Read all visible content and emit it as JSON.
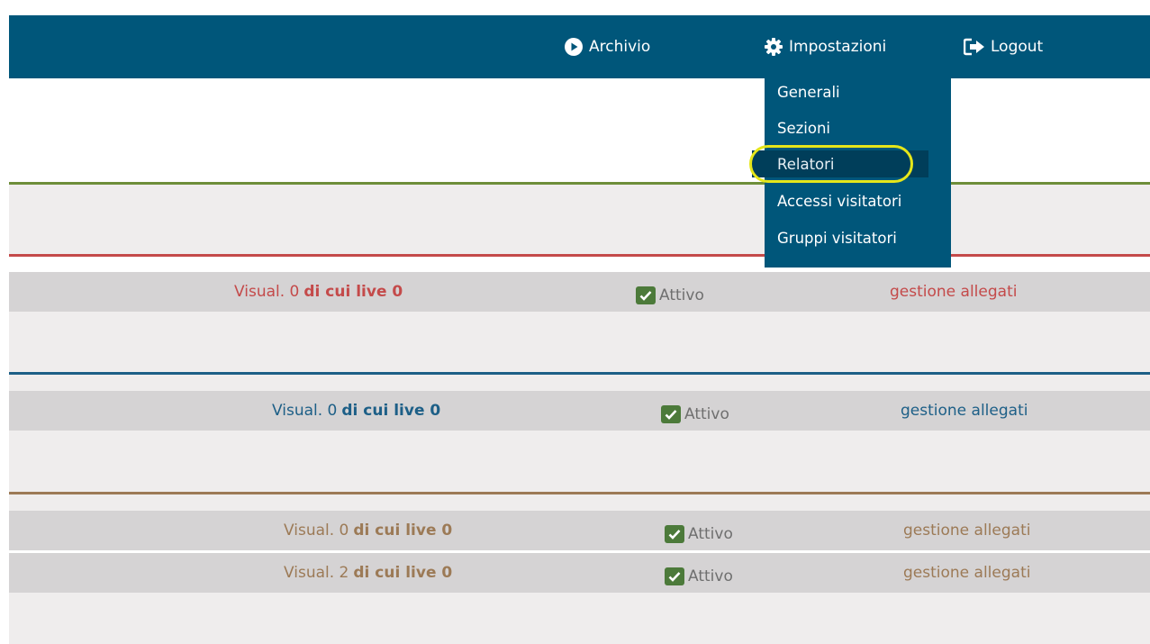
{
  "nav": {
    "archivio": "Archivio",
    "impostazioni": "Impostazioni",
    "logout": "Logout"
  },
  "dropdown": {
    "items": [
      "Generali",
      "Sezioni",
      "Relatori",
      "Accessi visitatori",
      "Gruppi visitatori"
    ],
    "highlighted": "Relatori"
  },
  "sections": [
    {
      "color": "#c44a4a",
      "rows": [
        {
          "visual": "Visual. 0",
          "live": "di cui live 0",
          "status": "Attivo",
          "link": "gestione allegati"
        }
      ]
    },
    {
      "color": "#1d5f87",
      "rows": [
        {
          "visual": "Visual. 0",
          "live": "di cui live 0",
          "status": "Attivo",
          "link": "gestione allegati"
        }
      ]
    },
    {
      "color": "#9c7a56",
      "rows": [
        {
          "visual": "Visual. 0",
          "live": "di cui live 0",
          "status": "Attivo",
          "link": "gestione allegati"
        },
        {
          "visual": "Visual. 2",
          "live": "di cui live 0",
          "status": "Attivo",
          "link": "gestione allegati"
        }
      ]
    }
  ],
  "colors": {
    "navbar": "#00567a",
    "green_divider": "#6e8e3a",
    "checkbox": "#4c7a3a",
    "highlight": "#e5e61a"
  }
}
